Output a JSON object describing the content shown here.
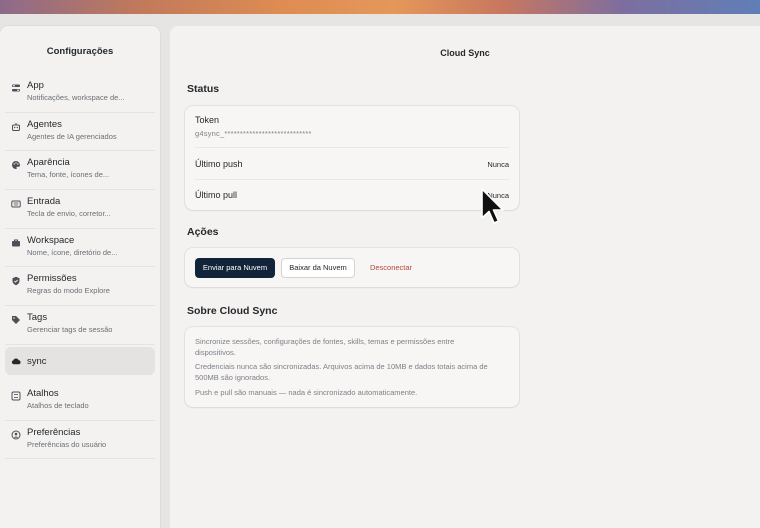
{
  "sidebar": {
    "title": "Configurações",
    "items": [
      {
        "icon": "app-icon",
        "label": "App",
        "sub": "Notificações, workspace de..."
      },
      {
        "icon": "agents-icon",
        "label": "Agentes",
        "sub": "Agentes de IA gerenciados"
      },
      {
        "icon": "palette-icon",
        "label": "Aparência",
        "sub": "Tema, fonte, ícones de..."
      },
      {
        "icon": "keyboard-icon",
        "label": "Entrada",
        "sub": "Tecla de envio, corretor..."
      },
      {
        "icon": "briefcase-icon",
        "label": "Workspace",
        "sub": "Nome, ícone, diretório de..."
      },
      {
        "icon": "shield-icon",
        "label": "Permissões",
        "sub": "Regras do modo Explore"
      },
      {
        "icon": "tag-icon",
        "label": "Tags",
        "sub": "Gerenciar tags de sessão"
      },
      {
        "icon": "cloud-icon",
        "label": "sync",
        "sub": ""
      },
      {
        "icon": "shortcut-icon",
        "label": "Atalhos",
        "sub": "Atalhos de teclado"
      },
      {
        "icon": "user-icon",
        "label": "Preferências",
        "sub": "Preferências do usuário"
      }
    ]
  },
  "main": {
    "title": "Cloud Sync",
    "status": {
      "heading": "Status",
      "token_label": "Token",
      "token_value": "g4sync_****************************",
      "last_push_label": "Último push",
      "last_push_value": "Nunca",
      "last_pull_label": "Último pull",
      "last_pull_value": "Nunca"
    },
    "actions": {
      "heading": "Ações",
      "push_button": "Enviar para Nuvem",
      "pull_button": "Baixar da Nuvem",
      "disconnect_button": "Desconectar"
    },
    "about": {
      "heading": "Sobre Cloud Sync",
      "p1": "Sincronize sessões, configurações de fontes, skills, temas e permissões entre dispositivos.",
      "p2": "Credenciais nunca são sincronizadas. Arquivos acima de 10MB e dados totais acima de 500MB são ignorados.",
      "p3": "Push e pull são manuais — nada é sincronizado automaticamente."
    }
  },
  "colors": {
    "primary_button": "#12243a",
    "danger_link": "#b0473d"
  }
}
